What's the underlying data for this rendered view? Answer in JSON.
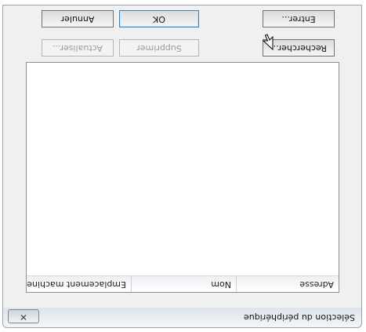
{
  "window": {
    "title": "Sélection du périphérique",
    "close_glyph": "✕"
  },
  "table": {
    "columns": [
      "Adresse",
      "Nom",
      "Emplacement machine"
    ],
    "rows": []
  },
  "buttons": {
    "rechercher": "Rechercher...",
    "supprimer": "Supprimer",
    "actualiser": "Actualiser...",
    "entrer": "Entrer...",
    "ok": "OK",
    "annuler": "Annuler"
  },
  "icons": {
    "close": "close-icon",
    "cursor": "mouse-pointer-icon"
  }
}
